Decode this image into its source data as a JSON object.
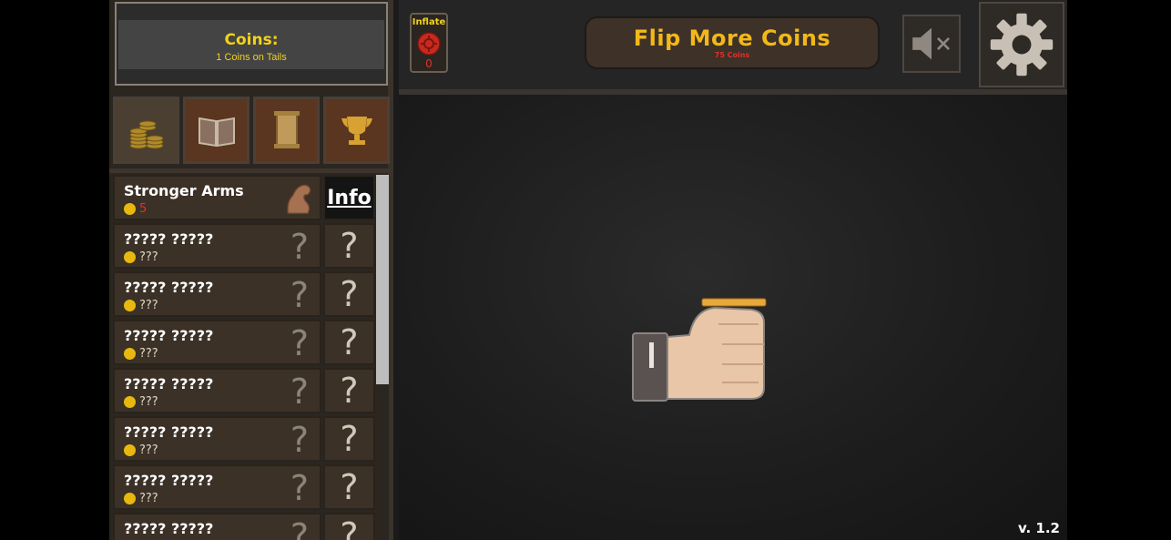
{
  "header": {
    "coins_title": "Coins:",
    "coins_subtitle": "1 Coins on Tails"
  },
  "tabs": [
    {
      "name": "coins",
      "icon": "coin-stack-icon"
    },
    {
      "name": "book",
      "icon": "book-icon"
    },
    {
      "name": "scroll",
      "icon": "scroll-icon"
    },
    {
      "name": "trophy",
      "icon": "trophy-icon"
    }
  ],
  "upgrades": [
    {
      "name": "Stronger Arms",
      "cost": "5",
      "icon": "bicep-icon",
      "button": "Info"
    },
    {
      "name": "????? ?????",
      "cost": "???",
      "icon": "?",
      "button": "?"
    },
    {
      "name": "????? ?????",
      "cost": "???",
      "icon": "?",
      "button": "?"
    },
    {
      "name": "????? ?????",
      "cost": "???",
      "icon": "?",
      "button": "?"
    },
    {
      "name": "????? ?????",
      "cost": "???",
      "icon": "?",
      "button": "?"
    },
    {
      "name": "????? ?????",
      "cost": "???",
      "icon": "?",
      "button": "?"
    },
    {
      "name": "????? ?????",
      "cost": "???",
      "icon": "?",
      "button": "?"
    },
    {
      "name": "????? ?????",
      "cost": "???",
      "icon": "?",
      "button": "?"
    }
  ],
  "inflate": {
    "label": "Inflate",
    "value": "0"
  },
  "flip": {
    "label": "Flip More Coins",
    "cost": "75 Coins"
  },
  "version": "v. 1.2",
  "colors": {
    "gold": "#f2d21a",
    "orange_gold": "#f2b81a",
    "red": "#e0312a"
  }
}
